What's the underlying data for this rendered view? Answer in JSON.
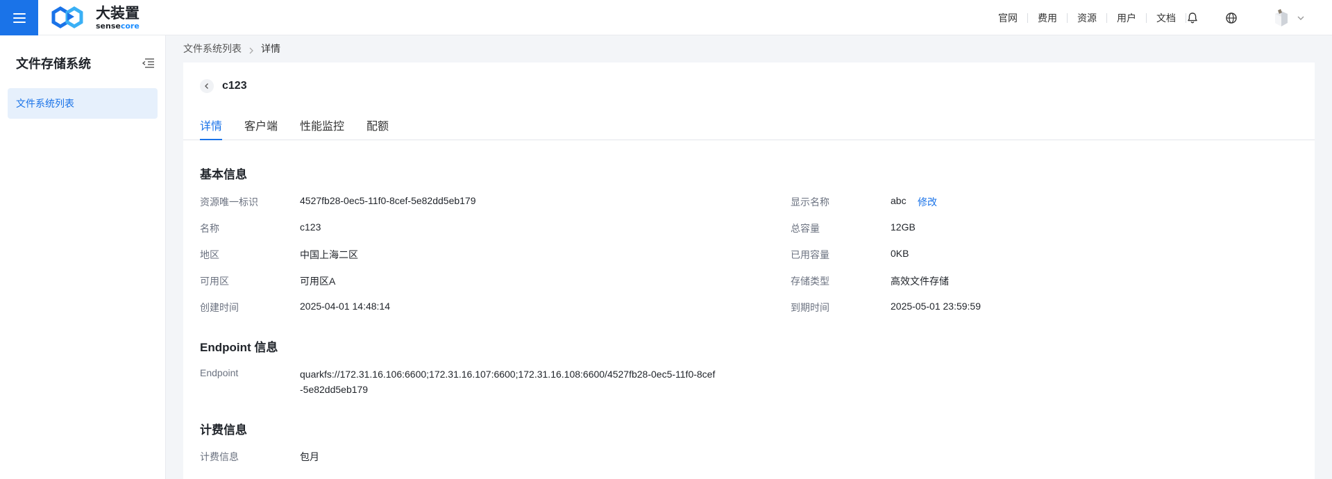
{
  "header": {
    "logo_cn": "大装置",
    "logo_en_prefix": "sense",
    "logo_en_suffix": "core",
    "nav": [
      "官网",
      "费用",
      "资源",
      "用户",
      "文档"
    ],
    "colors": {
      "primary": "#1a73e8"
    }
  },
  "sidebar": {
    "title": "文件存储系统",
    "items": [
      {
        "label": "文件系统列表",
        "active": true
      }
    ]
  },
  "breadcrumb": {
    "parent": "文件系统列表",
    "current": "详情"
  },
  "detail": {
    "title": "c123",
    "tabs": [
      "详情",
      "客户端",
      "性能监控",
      "配额"
    ],
    "basic": {
      "heading": "基本信息",
      "left": [
        {
          "label": "资源唯一标识",
          "value": "4527fb28-0ec5-11f0-8cef-5e82dd5eb179"
        },
        {
          "label": "名称",
          "value": "c123"
        },
        {
          "label": "地区",
          "value": "中国上海二区"
        },
        {
          "label": "可用区",
          "value": "可用区A"
        },
        {
          "label": "创建时间",
          "value": "2025-04-01 14:48:14"
        }
      ],
      "right": [
        {
          "label": "显示名称",
          "value": "abc",
          "action": "修改"
        },
        {
          "label": "总容量",
          "value": "12GB"
        },
        {
          "label": "已用容量",
          "value": "0KB"
        },
        {
          "label": "存储类型",
          "value": "高效文件存储"
        },
        {
          "label": "到期时间",
          "value": "2025-05-01 23:59:59"
        }
      ]
    },
    "endpoint": {
      "heading": "Endpoint 信息",
      "label": "Endpoint",
      "value": "quarkfs://172.31.16.106:6600;172.31.16.107:6600;172.31.16.108:6600/4527fb28-0ec5-11f0-8cef-5e82dd5eb179"
    },
    "billing": {
      "heading": "计费信息",
      "label": "计费信息",
      "value": "包月"
    }
  }
}
